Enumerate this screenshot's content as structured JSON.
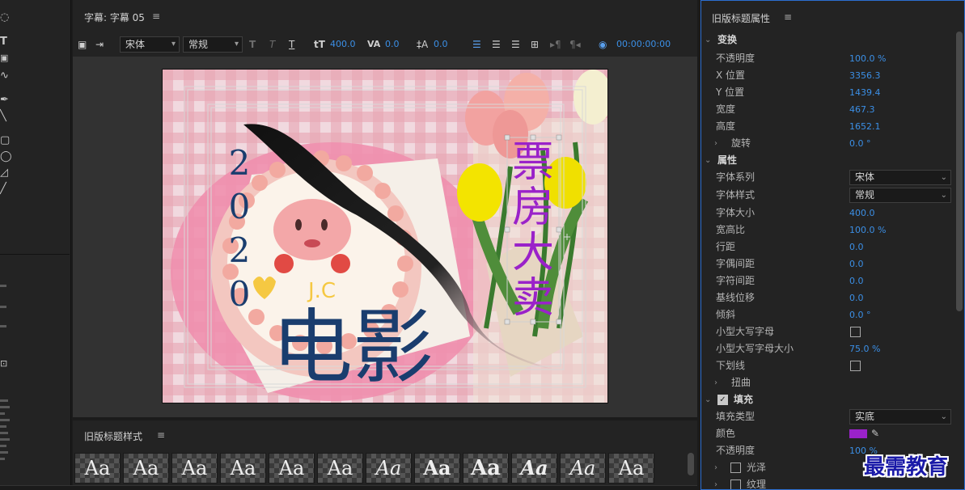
{
  "title_panel": {
    "title": "字幕: 字幕 05",
    "menu_glyph": "≡",
    "toolbar": {
      "font_family": "宋体",
      "font_style": "常规",
      "font_size": "400.0",
      "kerning": "0.0",
      "leading": "0.0",
      "timecode": "00:00:00:00"
    }
  },
  "styles_panel": {
    "title": "旧版标题样式",
    "swatch_label": "Aa",
    "swatch_count": 12
  },
  "canvas_texts": {
    "year": "2020",
    "movie": "电影",
    "box_office": "票房大卖"
  },
  "props_panel": {
    "title": "旧版标题属性",
    "transform": {
      "section": "变换",
      "opacity_label": "不透明度",
      "opacity": "100.0 %",
      "x_label": "X 位置",
      "x": "3356.3",
      "y_label": "Y 位置",
      "y": "1439.4",
      "width_label": "宽度",
      "width": "467.3",
      "height_label": "高度",
      "height": "1652.1",
      "rotation_label": "旋转",
      "rotation": "0.0 °"
    },
    "properties": {
      "section": "属性",
      "font_family_label": "字体系列",
      "font_family": "宋体",
      "font_style_label": "字体样式",
      "font_style": "常规",
      "font_size_label": "字体大小",
      "font_size": "400.0",
      "aspect_label": "宽高比",
      "aspect": "100.0 %",
      "leading_label": "行距",
      "leading": "0.0",
      "kerning_label": "字偶间距",
      "kerning": "0.0",
      "tracking_label": "字符间距",
      "tracking": "0.0",
      "baseline_label": "基线位移",
      "baseline": "0.0",
      "slant_label": "倾斜",
      "slant": "0.0 °",
      "small_caps_label": "小型大写字母",
      "small_caps_size_label": "小型大写字母大小",
      "small_caps_size": "75.0 %",
      "underline_label": "下划线",
      "distort_label": "扭曲"
    },
    "fill": {
      "section": "填充",
      "fill_type_label": "填充类型",
      "fill_type": "实底",
      "color_label": "颜色",
      "color": "#9a22c9",
      "opacity_label": "不透明度",
      "opacity": "100 %",
      "sheen_label": "光泽",
      "texture_label": "纹理"
    }
  },
  "watermark": "最需教育",
  "colors": {
    "accent": "#3b8fe6",
    "panel": "#232323",
    "canvas_bg": "#323232",
    "title_blue": "#1a3d6e",
    "fill_purple": "#9a22c9"
  }
}
